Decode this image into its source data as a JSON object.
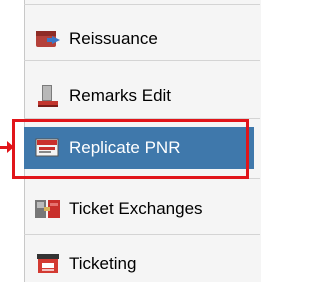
{
  "menu": {
    "items": [
      {
        "label": "Reissuance",
        "icon": "reissuance-icon",
        "selected": false
      },
      {
        "label": "Remarks Edit",
        "icon": "remarks-edit-icon",
        "selected": false
      },
      {
        "label": "Replicate PNR",
        "icon": "replicate-pnr-icon",
        "selected": true
      },
      {
        "label": "Ticket Exchanges",
        "icon": "ticket-exchanges-icon",
        "selected": false
      },
      {
        "label": "Ticketing",
        "icon": "ticketing-icon",
        "selected": false
      }
    ]
  },
  "colors": {
    "selected_background": "#3f78ab",
    "highlight_border": "#e1151a",
    "menu_background": "#f5f5f5"
  }
}
